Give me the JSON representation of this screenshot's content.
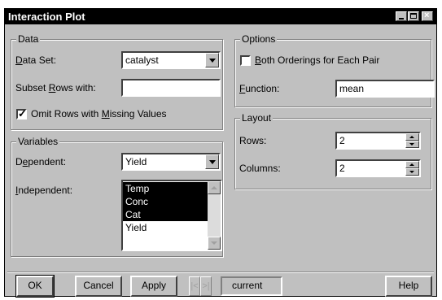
{
  "window": {
    "title": "Interaction Plot"
  },
  "data_group": {
    "title": "Data",
    "data_set_label_pre": "",
    "data_set_label_u": "D",
    "data_set_label_post": "ata Set:",
    "data_set_value": "catalyst",
    "subset_label_pre": "Subset ",
    "subset_label_u": "R",
    "subset_label_post": "ows with:",
    "subset_value": "",
    "omit_label_pre": "Omit Rows with ",
    "omit_label_u": "M",
    "omit_label_post": "issing Values",
    "omit_checked": true
  },
  "variables_group": {
    "title": "Variables",
    "dependent_label_pre": "D",
    "dependent_label_u": "e",
    "dependent_label_post": "pendent:",
    "dependent_value": "Yield",
    "independent_label_pre": "",
    "independent_label_u": "I",
    "independent_label_post": "ndependent:",
    "independent_items": [
      {
        "label": "Temp",
        "selected": true
      },
      {
        "label": "Conc",
        "selected": true
      },
      {
        "label": "Cat",
        "selected": true
      },
      {
        "label": "Yield",
        "selected": false
      }
    ]
  },
  "options_group": {
    "title": "Options",
    "both_orderings_pre": "",
    "both_orderings_u": "B",
    "both_orderings_post": "oth Orderings for Each Pair",
    "both_orderings_checked": false,
    "function_label_pre": "",
    "function_label_u": "F",
    "function_label_post": "unction:",
    "function_value": "mean"
  },
  "layout_group": {
    "title": "Layout",
    "rows_label": "Rows:",
    "rows_value": "2",
    "columns_label": "Columns:",
    "columns_value": "2"
  },
  "buttons": {
    "ok": "OK",
    "cancel": "Cancel",
    "apply": "Apply",
    "prev": "|<",
    "next": ">|",
    "current": "current",
    "help": "Help"
  }
}
